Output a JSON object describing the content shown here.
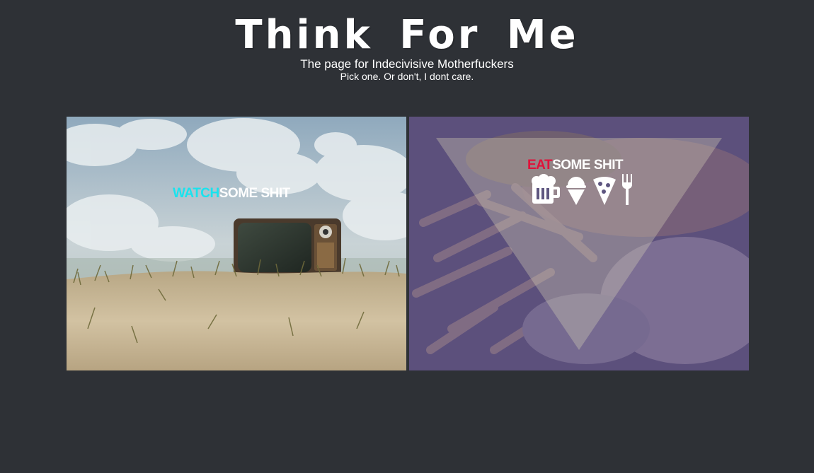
{
  "header": {
    "title": "Think For Me",
    "subtitle": "The page for Indecivisive Motherfuckers",
    "tagline": "Pick one. Or don't, I dont care."
  },
  "panels": {
    "watch": {
      "accent": "WATCH",
      "rest": "SOME SHIT",
      "accent_color": "#19e3ee"
    },
    "eat": {
      "accent": "EAT",
      "rest": "SOME SHIT",
      "accent_color": "#e0123a",
      "icons": [
        "beer-mug-icon",
        "ice-cream-icon",
        "pizza-slice-icon",
        "fork-icon"
      ]
    }
  },
  "colors": {
    "background": "#2e3136",
    "overlay": "#5e5680"
  }
}
